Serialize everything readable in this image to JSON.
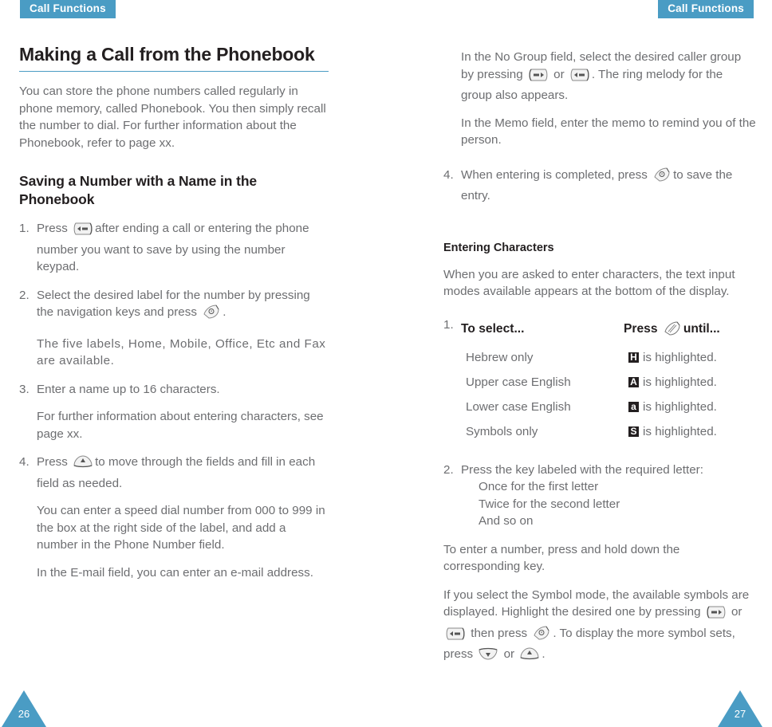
{
  "header": {
    "left_tab": "Call Functions",
    "right_tab": "Call Functions"
  },
  "theme": {
    "accent": "#4a9cc4",
    "body_text": "#6d6e71",
    "heading_text": "#231f20",
    "badge_bg": "#231f20"
  },
  "left_page": {
    "title": "Making a Call from the Phonebook",
    "intro": "You can store the phone numbers called regularly in phone memory, called Phonebook. You then simply recall the number to dial. For further information about the Phonebook, refer to page xx.",
    "subhead": "Saving a Number with a Name in the Phonebook",
    "steps": [
      {
        "num": "1.",
        "text_before": "Press",
        "icon": "side-key-right-icon",
        "text_after": "after ending a call or entering the phone number you want to save by using the number keypad."
      },
      {
        "num": "2.",
        "text_before": "Select the desired label for the number by pressing the navigation keys and press",
        "icon": "soft-key-select-icon",
        "text_after": "."
      },
      {
        "num": "3.",
        "text_before": "Enter a name up to 16 characters.",
        "icon": "",
        "text_after": ""
      },
      {
        "num": "4.",
        "text_before": "Press",
        "icon": "nav-key-up-icon",
        "text_after": "to move through the fields and fill in each field as needed."
      }
    ],
    "note_after_step2": "The five labels, Home, Mobile, Office, Etc and Fax are available.",
    "note_after_step3": "For further information about entering characters, see page xx.",
    "note_after_step4_a": "You can enter a speed dial number from 000 to 999 in the box at the right side of the label, and add a number in the Phone Number field.",
    "note_after_step4_b": "In the E-mail field, you can enter an e-mail address.",
    "page_number": "26"
  },
  "right_page": {
    "note_group_before": "In the No Group field, select the desired caller group by pressing",
    "note_group_icon1": "side-key-left-icon",
    "note_group_or": "or",
    "note_group_icon2": "side-key-right-icon",
    "note_group_after": ". The ring melody for the group also appears.",
    "note_memo": "In the Memo field, enter the memo to remind you of the person.",
    "step4": {
      "num": "4.",
      "text_before": "When entering is completed, press",
      "icon": "soft-key-select-icon",
      "text_after": "to save the entry."
    },
    "entering_characters": {
      "heading": "Entering Characters",
      "intro": "When you are asked to enter characters, the text input modes available appears at the bottom of the display.",
      "table_num": "1.",
      "col1_header": "To select...",
      "col2_header_before": "Press",
      "col2_header_icon": "text-mode-key-icon",
      "col2_header_after": "until...",
      "rows": [
        {
          "mode": "Hebrew only",
          "badge": "H",
          "result": "is highlighted."
        },
        {
          "mode": "Upper case English",
          "badge": "A",
          "result": "is highlighted."
        },
        {
          "mode": "Lower case English",
          "badge": "a",
          "result": "is highlighted."
        },
        {
          "mode": "Symbols only",
          "badge": "S",
          "result": "is highlighted."
        }
      ]
    },
    "step2": {
      "num": "2.",
      "text": "Press the key labeled with the required letter:",
      "sublines": [
        "Once for the first letter",
        "Twice for the second letter",
        "And so on"
      ]
    },
    "note_number": "To enter a number, press and hold down the corresponding key.",
    "note_symbol_a": "If you select the Symbol mode, the available symbols are displayed. Highlight the desired one by pressing",
    "note_symbol_icon1": "side-key-left-icon",
    "note_symbol_or1": "or",
    "note_symbol_icon2": "side-key-right-icon",
    "note_symbol_b": "then press",
    "note_symbol_icon3": "soft-key-select-icon",
    "note_symbol_c": ". To display the more symbol sets, press",
    "note_symbol_icon4": "nav-key-down-icon",
    "note_symbol_or2": "or",
    "note_symbol_icon5": "nav-key-up-icon",
    "note_symbol_d": ".",
    "page_number": "27"
  }
}
